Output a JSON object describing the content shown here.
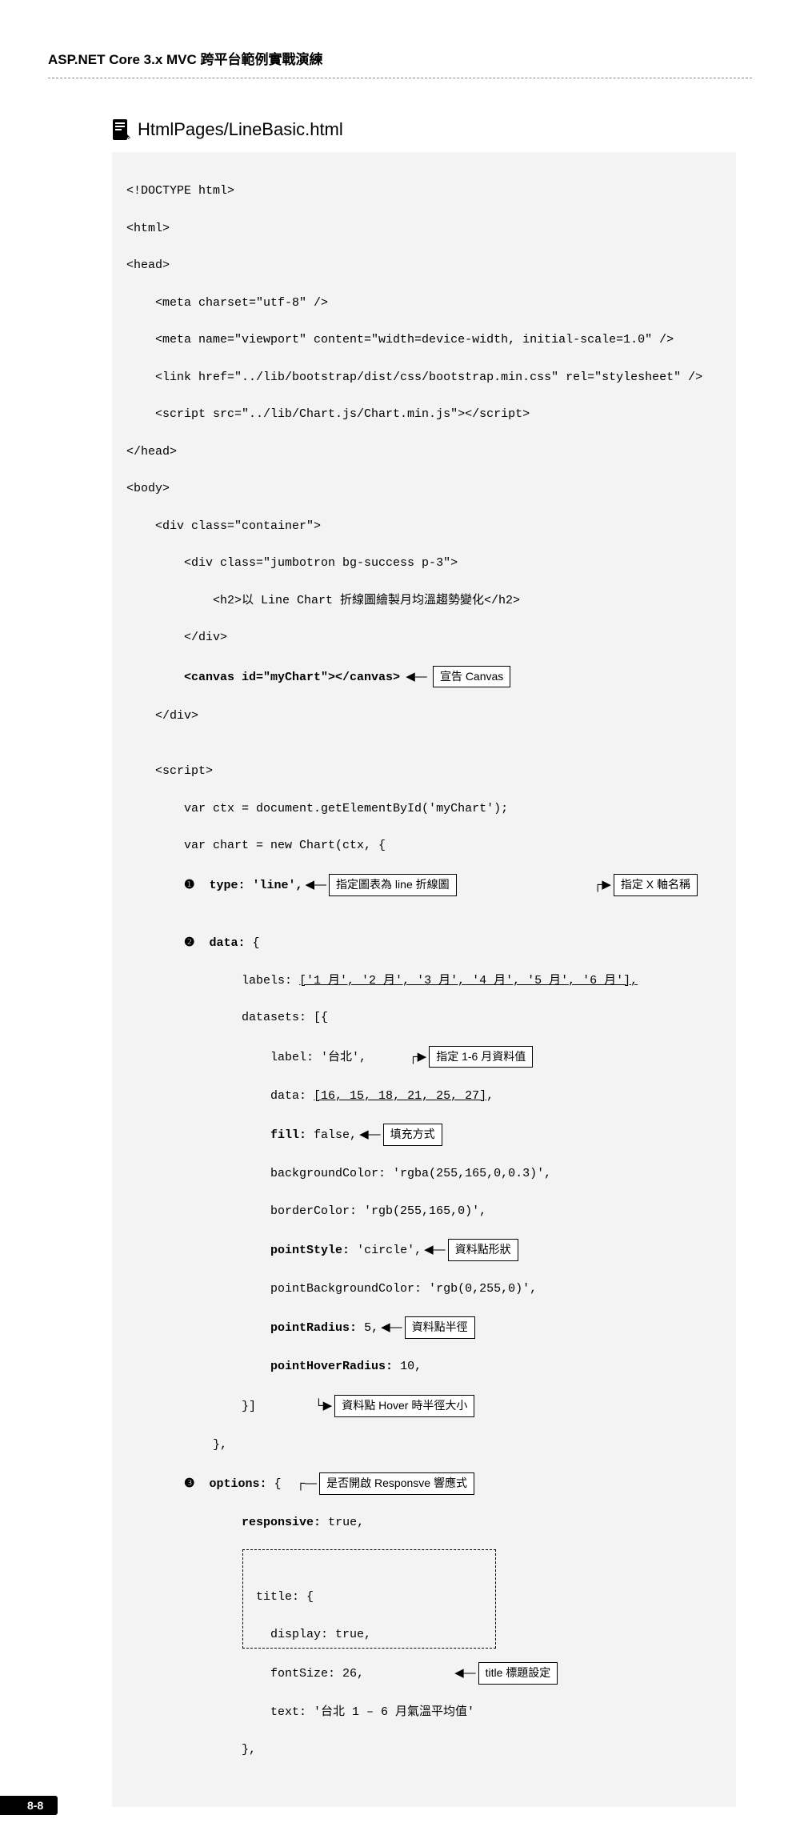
{
  "header": "ASP.NET Core 3.x MVC 跨平台範例實戰演練",
  "file_title": "HtmlPages/LineBasic.html",
  "code": {
    "l1": "<!DOCTYPE html>",
    "l2": "<html>",
    "l3": "<head>",
    "l4": "    <meta charset=\"utf-8\" />",
    "l5": "    <meta name=\"viewport\" content=\"width=device-width, initial-scale=1.0\" />",
    "l6": "    <link href=\"../lib/bootstrap/dist/css/bootstrap.min.css\" rel=\"stylesheet\" />",
    "l7": "    <script src=\"../lib/Chart.js/Chart.min.js\"></script>",
    "l8": "</head>",
    "l9": "<body>",
    "l10": "    <div class=\"container\">",
    "l11": "        <div class=\"jumbotron bg-success p-3\">",
    "l12": "            <h2>以 Line Chart 折線圖繪製月均溫趨勢變化</h2>",
    "l13": "        </div>",
    "l14a": "        ",
    "l14b": "<canvas id=\"myChart\"></canvas>",
    "l15": "    </div>",
    "l16": "",
    "l17": "    <script>",
    "l18": "        var ctx = document.getElementById('myChart');",
    "l19": "        var chart = new Chart(ctx, {",
    "l20a": "        ",
    "l20b": "❶",
    "l20c": "  type: 'line',",
    "l21a": "        ",
    "l21b": "❷",
    "l21c": "  data:",
    "l21d": " {",
    "l22a": "                labels: ",
    "l22b": "['1 月', '2 月', '3 月', '4 月', '5 月', '6 月'],",
    "l23": "                datasets: [{",
    "l24": "                    label: '台北',",
    "l25a": "                    data: ",
    "l25b": "[16, 15, 18, 21, 25, 27]",
    "l25c": ",",
    "l26a": "                    ",
    "l26b": "fill:",
    "l26c": " false,",
    "l27": "                    backgroundColor: 'rgba(255,165,0,0.3)',",
    "l28": "                    borderColor: 'rgb(255,165,0)',",
    "l29a": "                    ",
    "l29b": "pointStyle:",
    "l29c": " 'circle',",
    "l30": "                    pointBackgroundColor: 'rgb(0,255,0)',",
    "l31a": "                    ",
    "l31b": "pointRadius:",
    "l31c": " 5,",
    "l32a": "                    ",
    "l32b": "pointHoverRadius:",
    "l32c": " 10,",
    "l33": "                }]",
    "l34": "            },",
    "l35a": "        ",
    "l35b": "❸",
    "l35c": "  options:",
    "l35d": " {",
    "l36a": "                ",
    "l36b": "responsive:",
    "l36c": " true,",
    "l37": "                title: {",
    "l38": "                    display: true,",
    "l39": "                    fontSize: 26,",
    "l40": "                    text: '台北 1 – 6 月氣溫平均值'",
    "l41": "                },"
  },
  "callouts": {
    "canvas": "宣告 Canvas",
    "type_line": "指定圖表為 line 折線圖",
    "x_axis": "指定 X 軸名稱",
    "data_1_6": "指定 1-6 月資料值",
    "fill": "填充方式",
    "point_style": "資料點形狀",
    "point_radius": "資料點半徑",
    "point_hover": "資料點 Hover 時半徑大小",
    "responsive": "是否開啟 Responsve 響應式",
    "title": "title 標題設定"
  },
  "page_num": "8-8",
  "chart_data": {
    "type": "line",
    "categories": [
      "1 月",
      "2 月",
      "3 月",
      "4 月",
      "5 月",
      "6 月"
    ],
    "series": [
      {
        "name": "台北",
        "values": [
          16,
          15,
          18,
          21,
          25,
          27
        ]
      }
    ],
    "title": "台北 1 – 6 月氣溫平均值",
    "xlabel": "",
    "ylabel": "",
    "options": {
      "fill": false,
      "backgroundColor": "rgba(255,165,0,0.3)",
      "borderColor": "rgb(255,165,0)",
      "pointStyle": "circle",
      "pointBackgroundColor": "rgb(0,255,0)",
      "pointRadius": 5,
      "pointHoverRadius": 10,
      "responsive": true,
      "titleFontSize": 26
    }
  }
}
